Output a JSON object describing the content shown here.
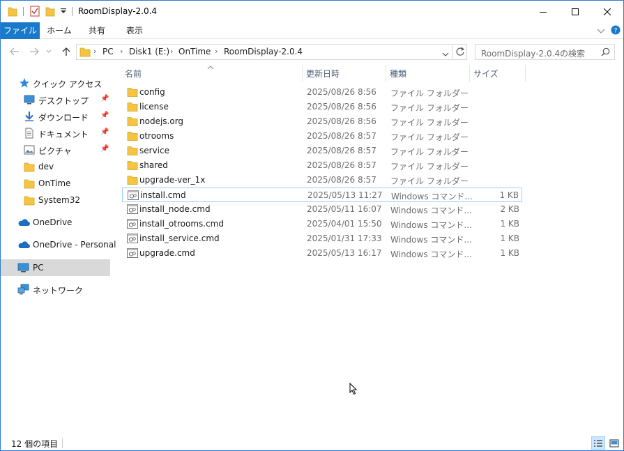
{
  "window": {
    "title": "RoomDisplay-2.0.4"
  },
  "ribbon": {
    "tabs": [
      "ファイル",
      "ホーム",
      "共有",
      "表示"
    ]
  },
  "address": {
    "crumbs": [
      "PC",
      "Disk1 (E:)",
      "OnTime",
      "RoomDisplay-2.0.4"
    ]
  },
  "search": {
    "placeholder": "RoomDisplay-2.0.4の検索"
  },
  "sidebar": {
    "quick_access": "クイック アクセス",
    "pinned": [
      {
        "label": "デスクトップ",
        "icon": "desktop-icon"
      },
      {
        "label": "ダウンロード",
        "icon": "download-icon"
      },
      {
        "label": "ドキュメント",
        "icon": "document-icon"
      },
      {
        "label": "ピクチャ",
        "icon": "pictures-icon"
      }
    ],
    "folders": [
      "dev",
      "OnTime",
      "System32"
    ],
    "onedrive": "OneDrive",
    "onedrive_personal": "OneDrive - Personal",
    "pc": "PC",
    "network": "ネットワーク"
  },
  "columns": {
    "name": "名前",
    "date": "更新日時",
    "type": "種類",
    "size": "サイズ"
  },
  "files": [
    {
      "name": "config",
      "date": "2025/08/26 8:56",
      "type": "ファイル フォルダー",
      "size": "",
      "kind": "folder"
    },
    {
      "name": "license",
      "date": "2025/08/26 8:56",
      "type": "ファイル フォルダー",
      "size": "",
      "kind": "folder"
    },
    {
      "name": "nodejs.org",
      "date": "2025/08/26 8:56",
      "type": "ファイル フォルダー",
      "size": "",
      "kind": "folder"
    },
    {
      "name": "otrooms",
      "date": "2025/08/26 8:57",
      "type": "ファイル フォルダー",
      "size": "",
      "kind": "folder"
    },
    {
      "name": "service",
      "date": "2025/08/26 8:57",
      "type": "ファイル フォルダー",
      "size": "",
      "kind": "folder"
    },
    {
      "name": "shared",
      "date": "2025/08/26 8:57",
      "type": "ファイル フォルダー",
      "size": "",
      "kind": "folder"
    },
    {
      "name": "upgrade-ver_1x",
      "date": "2025/08/26 8:57",
      "type": "ファイル フォルダー",
      "size": "",
      "kind": "folder"
    },
    {
      "name": "install.cmd",
      "date": "2025/05/13 11:27",
      "type": "Windows コマンド...",
      "size": "1 KB",
      "kind": "cmd"
    },
    {
      "name": "install_node.cmd",
      "date": "2025/05/11 16:07",
      "type": "Windows コマンド...",
      "size": "2 KB",
      "kind": "cmd"
    },
    {
      "name": "install_otrooms.cmd",
      "date": "2025/04/01 15:50",
      "type": "Windows コマンド...",
      "size": "1 KB",
      "kind": "cmd"
    },
    {
      "name": "install_service.cmd",
      "date": "2025/01/31 17:33",
      "type": "Windows コマンド...",
      "size": "1 KB",
      "kind": "cmd"
    },
    {
      "name": "upgrade.cmd",
      "date": "2025/05/13 16:17",
      "type": "Windows コマンド...",
      "size": "1 KB",
      "kind": "cmd"
    }
  ],
  "status": {
    "item_count": "12 個の項目"
  },
  "colors": {
    "accent": "#1979ca",
    "folder": "#f5c542",
    "selection_border": "#99d1ff"
  }
}
